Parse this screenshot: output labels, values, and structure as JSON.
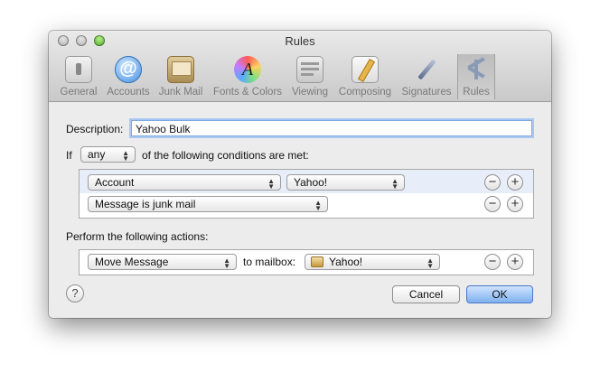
{
  "window": {
    "title": "Rules"
  },
  "toolbar": {
    "items": [
      {
        "label": "General",
        "icon": "light-switch-icon"
      },
      {
        "label": "Accounts",
        "icon": "at-sign-icon"
      },
      {
        "label": "Junk Mail",
        "icon": "junk-trash-icon"
      },
      {
        "label": "Fonts & Colors",
        "icon": "fonts-colors-icon"
      },
      {
        "label": "Viewing",
        "icon": "viewing-icon"
      },
      {
        "label": "Composing",
        "icon": "composing-pencil-icon"
      },
      {
        "label": "Signatures",
        "icon": "signature-pen-icon"
      },
      {
        "label": "Rules",
        "icon": "rules-icon"
      }
    ]
  },
  "rule": {
    "description_label": "Description:",
    "description_value": "Yahoo Bulk",
    "if_label": "If",
    "match_value": "any",
    "conditions_label": "of the following conditions are met:",
    "conditions": [
      {
        "field": "Account",
        "value": "Yahoo!"
      },
      {
        "field": "Message is junk mail"
      }
    ],
    "actions_label": "Perform the following actions:",
    "actions": [
      {
        "action": "Move Message",
        "to_label": "to mailbox:",
        "mailbox": "Yahoo!"
      }
    ]
  },
  "buttons": {
    "help": "?",
    "cancel": "Cancel",
    "ok": "OK",
    "minus": "−",
    "plus": "+"
  },
  "colors": {
    "accent": "#7eb1ee",
    "focus_ring": "#a8c9f2"
  }
}
